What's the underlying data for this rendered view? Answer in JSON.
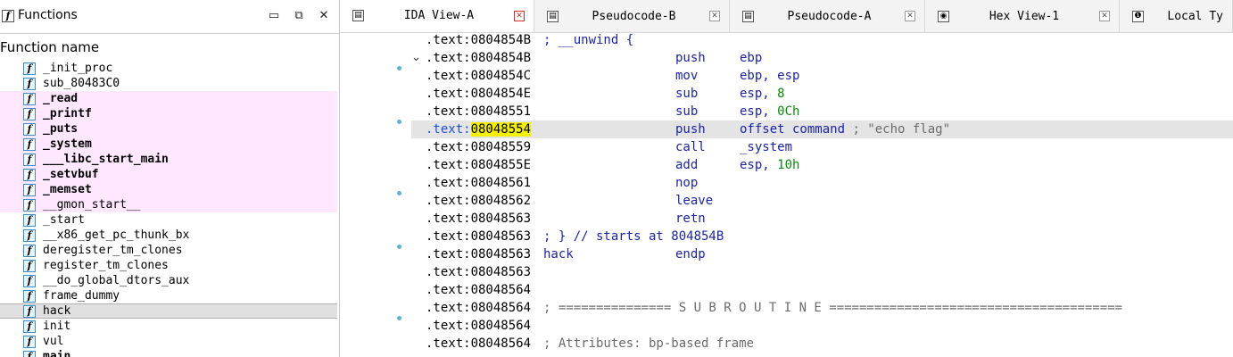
{
  "functions_panel": {
    "title": "Functions",
    "title_icon": "function-f-icon",
    "buttons": {
      "restore": "▭",
      "float": "⧉",
      "close": "✕"
    },
    "header": "Function name",
    "items": [
      {
        "name": "_init_proc",
        "style": "normal"
      },
      {
        "name": "sub_80483C0",
        "style": "normal"
      },
      {
        "name": "_read",
        "style": "lib"
      },
      {
        "name": "_printf",
        "style": "lib"
      },
      {
        "name": "_puts",
        "style": "lib"
      },
      {
        "name": "_system",
        "style": "lib"
      },
      {
        "name": "___libc_start_main",
        "style": "lib"
      },
      {
        "name": "_setvbuf",
        "style": "lib"
      },
      {
        "name": "_memset",
        "style": "lib"
      },
      {
        "name": "__gmon_start__",
        "style": "lib-normal"
      },
      {
        "name": "_start",
        "style": "normal"
      },
      {
        "name": "__x86_get_pc_thunk_bx",
        "style": "normal"
      },
      {
        "name": "deregister_tm_clones",
        "style": "normal"
      },
      {
        "name": "register_tm_clones",
        "style": "normal"
      },
      {
        "name": "__do_global_dtors_aux",
        "style": "normal"
      },
      {
        "name": "frame_dummy",
        "style": "normal"
      },
      {
        "name": "hack",
        "style": "selected"
      },
      {
        "name": "init",
        "style": "normal"
      },
      {
        "name": "vul",
        "style": "normal"
      },
      {
        "name": "main",
        "style": "bold"
      }
    ]
  },
  "tabs": [
    {
      "label": "IDA View-A",
      "icon": "disassembly-icon",
      "active": true,
      "close": "✕"
    },
    {
      "label": "Pseudocode-B",
      "icon": "pseudocode-icon",
      "active": false,
      "close": "✕"
    },
    {
      "label": "Pseudocode-A",
      "icon": "pseudocode-icon",
      "active": false,
      "close": "✕"
    },
    {
      "label": "Hex View-1",
      "icon": "hex-view-icon",
      "active": false,
      "close": "✕"
    },
    {
      "label": "Local Ty",
      "icon": "local-types-icon",
      "active": false,
      "close": ""
    }
  ],
  "disasm": {
    "lines": [
      {
        "seg": ".text:",
        "addr": "0804854B",
        "code": "; __unwind {",
        "kind": "comment-blue"
      },
      {
        "seg": ".text:",
        "addr": "0804854B",
        "mnem": "push",
        "ops": "ebp",
        "arrow": "⌄"
      },
      {
        "seg": ".text:",
        "addr": "0804854C",
        "mnem": "mov",
        "ops": "ebp, esp"
      },
      {
        "seg": ".text:",
        "addr": "0804854E",
        "mnem": "sub",
        "ops": "esp, ",
        "num": "8"
      },
      {
        "seg": ".text:",
        "addr": "08048551",
        "mnem": "sub",
        "ops": "esp, ",
        "num": "0Ch"
      },
      {
        "seg": ".text:",
        "addr": "08048554",
        "mnem": "push",
        "ops": "offset command",
        "cmt": " ; \"echo flag\"",
        "highlight": true
      },
      {
        "seg": ".text:",
        "addr": "08048559",
        "mnem": "call",
        "ops": "_system"
      },
      {
        "seg": ".text:",
        "addr": "0804855E",
        "mnem": "add",
        "ops": "esp, ",
        "num": "10h"
      },
      {
        "seg": ".text:",
        "addr": "08048561",
        "mnem": "nop"
      },
      {
        "seg": ".text:",
        "addr": "08048562",
        "mnem": "leave"
      },
      {
        "seg": ".text:",
        "addr": "08048563",
        "mnem": "retn"
      },
      {
        "seg": ".text:",
        "addr": "08048563",
        "code": "; } // starts at 804854B",
        "kind": "comment-blue"
      },
      {
        "seg": ".text:",
        "addr": "08048563",
        "code": "hack",
        "mnem": "endp",
        "kind": "label"
      },
      {
        "seg": ".text:",
        "addr": "08048563"
      },
      {
        "seg": ".text:",
        "addr": "08048564"
      },
      {
        "seg": ".text:",
        "addr": "08048564",
        "code": "; =============== S U B R O U T I N E =======================================",
        "kind": "comment-grey"
      },
      {
        "seg": ".text:",
        "addr": "08048564"
      },
      {
        "seg": ".text:",
        "addr": "08048564",
        "code": "; Attributes: bp-based frame",
        "kind": "comment-grey"
      }
    ]
  },
  "colors": {
    "library_function_bg": "#ffe8ff",
    "selected_row_bg": "#e0e0e0",
    "highlight_address": "#f4f100",
    "instruction_blue": "#1a24a6",
    "number_green": "#0a8a0a",
    "comment_grey": "#6b6b6b",
    "breakpoint_dot": "#5bb0e6"
  }
}
